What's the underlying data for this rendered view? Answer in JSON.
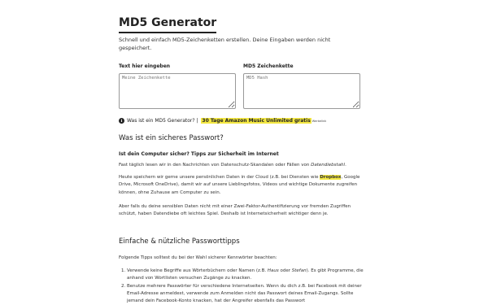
{
  "page": {
    "title": "MD5 Generator",
    "intro": "Schnell und einfach MD5-Zeichenketten erstellen. Deine Eingaben werden nicht gespeichert."
  },
  "form": {
    "input_label": "Text hier eingeben",
    "input_placeholder": "Meine Zeichenkette",
    "output_label": "MD5 Zeichenkette",
    "output_placeholder": "MD5 Hash"
  },
  "info": {
    "icon": "info-icon",
    "link_text": "Was ist ein MD5 Generator?",
    "separator": " | ",
    "promo_text": "30 Tage Amazon Music Unlimited gratis",
    "ad_tag": "Werbelink",
    "colors": {
      "highlight": "#f4e842"
    }
  },
  "section1": {
    "heading": "Was ist ein sicheres Passwort?",
    "subheading": "Ist dein Computer sicher? Tipps zur Sicherheit im Internet",
    "p1_text": "Fast täglich lesen wir in den Nachrichten von Datenschutz-Skandalen oder Fällen von ",
    "p1_em": "Datendiebstahl",
    "p1_end": ".",
    "p2_a": "Heute speichern wir gerne unsere persönlichen Daten in der Cloud (z.B. bei Diensten wie ",
    "p2_hl": "Dropbox",
    "p2_b": ", Google Drive, Microsoft OneDrive), damit wir auf unsere Lieblingsfotos, Videos und wichtige Dokumente zugreifen können, ohne Zuhause am Computer zu sein.",
    "p3": "Aber falls du deine sensiblen Daten nicht mit einer Zwei-Faktor-Authentifizierung vor fremden Zugriffen schützt, haben Datendiebe oft leichtes Spiel. Deshalb ist Internetsicherheit wichtiger denn je."
  },
  "section2": {
    "heading": "Einfache & nützliche Passworttipps",
    "intro": "Folgende Tipps solltest du bei der Wahl sicherer Kennwörter beachten:",
    "item1_a": "Verwende keine Begriffe aus Wörterbüchern oder Namen (z.B. ",
    "item1_em1": "Haus",
    "item1_b": " oder ",
    "item1_em2": "Stefan",
    "item1_c": "). Es gibt Programme, die anhand von Wortlisten versuchen Zugänge zu knacken.",
    "item2": "Benutze mehrere Passwörter für verschiedene Internetseiten. Wenn du dich z.B. bei Facebook mit deiner Email-Adresse anmeldest, verwende zum Anmelden nicht das Passwort deines Email-Zugangs. Sollte jemand dein Facebook-Konto knacken, hat der Angreifer ebenfalls das Passwort"
  }
}
